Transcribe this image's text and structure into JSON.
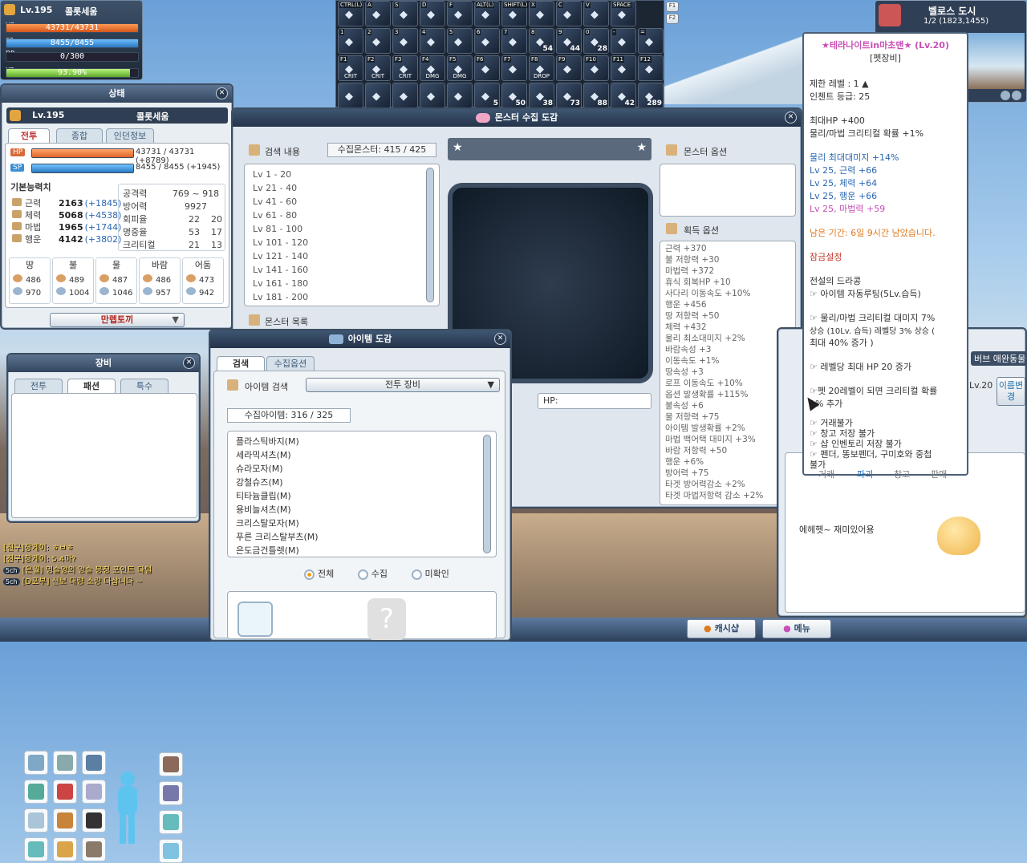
{
  "player": {
    "level": "Lv.195",
    "name": "콜롯세움",
    "hp_label": "HP",
    "mp_label": "SP",
    "dp_label": "DP",
    "xp_label": "XP",
    "hp": "43731/43731",
    "mp": "8455/8455",
    "dp": "0/300",
    "exp": "93.90%",
    "exp_fill": 0.939
  },
  "skills": {
    "row1": [
      {
        "key": "CTRL(L)"
      },
      {
        "key": "A"
      },
      {
        "key": "S"
      },
      {
        "key": "D"
      },
      {
        "key": "F"
      },
      {
        "key": "ALT(L)"
      },
      {
        "key": "SHIFT(L)"
      },
      {
        "key": "X"
      },
      {
        "key": "C"
      },
      {
        "key": "V"
      },
      {
        "key": "SPACE"
      }
    ],
    "row2": [
      {
        "key": "1"
      },
      {
        "key": "2"
      },
      {
        "key": "3"
      },
      {
        "key": "4"
      },
      {
        "key": "5"
      },
      {
        "key": "6"
      },
      {
        "key": "7"
      },
      {
        "key": "8"
      },
      {
        "key": "9"
      },
      {
        "key": "0"
      },
      {
        "key": "-"
      },
      {
        "key": "="
      }
    ],
    "row2_counts": [
      "",
      "",
      "",
      "",
      "",
      "",
      "",
      "54",
      "44",
      "28",
      "",
      ""
    ],
    "row3": [
      {
        "key": "F1",
        "label": "CRIT"
      },
      {
        "key": "F2",
        "label": "CRIT"
      },
      {
        "key": "F3",
        "label": "CRIT"
      },
      {
        "key": "F4",
        "label": "DMG"
      },
      {
        "key": "F5",
        "label": "DMG"
      },
      {
        "key": "F6",
        "label": ""
      },
      {
        "key": "F7",
        "label": ""
      },
      {
        "key": "F8",
        "label": "DROP"
      },
      {
        "key": "F9",
        "label": ""
      },
      {
        "key": "F10",
        "label": ""
      },
      {
        "key": "F11",
        "label": ""
      },
      {
        "key": "F12",
        "label": ""
      }
    ],
    "row4_counts": [
      "",
      "",
      "",
      "",
      "",
      "5",
      "50",
      "38",
      "73",
      "88",
      "42",
      "289"
    ],
    "pages": [
      "F1",
      "F2"
    ]
  },
  "minimap": {
    "title": "벨로스 도시",
    "coords": "1/2 (1823,1455)"
  },
  "status": {
    "title": "상태",
    "level": "Lv.195",
    "name": "콜롯세움",
    "tabs": [
      "전투",
      "종합",
      "인던정보"
    ],
    "hp_label": "HP",
    "hp": "43731 / 43731 (+8789)",
    "sp_label": "SP",
    "sp": "8455 / 8455 (+1945)",
    "section": "기본능력치",
    "stats": [
      {
        "name": "근력",
        "value": "2163",
        "bonus": "(+1845)"
      },
      {
        "name": "체력",
        "value": "5068",
        "bonus": "(+4538)"
      },
      {
        "name": "마법",
        "value": "1965",
        "bonus": "(+1744)"
      },
      {
        "name": "행운",
        "value": "4142",
        "bonus": "(+3802)"
      }
    ],
    "combat": [
      {
        "name": "공격력",
        "value": "769 ~ 918"
      },
      {
        "name": "방어력",
        "value": "9927"
      },
      {
        "name": "회피율",
        "v1": "22",
        "v2": "20"
      },
      {
        "name": "명중율",
        "v1": "53",
        "v2": "17"
      },
      {
        "name": "크리티컬",
        "v1": "21",
        "v2": "13"
      }
    ],
    "elements": [
      {
        "name": "땅",
        "a": "486",
        "b": "970"
      },
      {
        "name": "불",
        "a": "489",
        "b": "1004"
      },
      {
        "name": "물",
        "a": "487",
        "b": "1046"
      },
      {
        "name": "바람",
        "a": "486",
        "b": "957"
      },
      {
        "name": "어둠",
        "a": "473",
        "b": "942"
      }
    ],
    "bottom_button": "만렙토끼"
  },
  "equip": {
    "title": "장비",
    "tabs": [
      "전투",
      "패션",
      "특수"
    ]
  },
  "chat": {
    "lines": [
      "[친구]장게이: ㅎㅂㅎ",
      "[친구]장게이: 5.4마?",
      "[은월] 멍슬양의 양슬 뭉정 포인트 다털",
      "[D포부] 신보 대량 소량 다삽니다 ~"
    ],
    "channel": "5ch"
  },
  "monster_book": {
    "title": "몬스터 수집 도감",
    "search_title": "검색 내용",
    "collected": "수집몬스터: 415 / 425",
    "ranges": [
      "Lv 1 - 20",
      "Lv 21 - 40",
      "Lv 41 - 60",
      "Lv 61 - 80",
      "Lv 81 - 100",
      "Lv 101 - 120",
      "Lv 121 - 140",
      "Lv 141 - 160",
      "Lv 161 - 180",
      "Lv 181 - 200"
    ],
    "monster_list": "몬스터 목록",
    "monster_option": "몬스터 옵션",
    "gain_option": "획득 옵션",
    "gain_list": [
      "근력 +370",
      "불 저항력 +30",
      "마법력 +372",
      "휴식 회복HP +10",
      "사다리 이동속도 +10%",
      "행운 +456",
      "땅 저항력 +50",
      "체력 +432",
      "물리 최소대미지 +2%",
      "바람속성 +3",
      "이동속도 +1%",
      "땅속성 +3",
      "로프 이동속도 +10%",
      "옵션 발생확률 +115%",
      "불속성 +6",
      "물 저항력 +75",
      "아이템 발생확률 +2%",
      "마법 백어택 대미지 +3%",
      "바람 저항력 +50",
      "행운 +6%",
      "방어력 +75",
      "타겟 방어력감소 +2%",
      "타겟 마법저항력 감소 +2%"
    ],
    "hp_label": "HP:"
  },
  "item_book": {
    "title": "아이템 도감",
    "tabs": [
      "검색",
      "수집옵션"
    ],
    "search_label": "아이템 검색",
    "category": "전투 장비",
    "collected": "수집아이템: 316 / 325",
    "items": [
      "플라스틱바지(M)",
      "세라믹셔츠(M)",
      "슈라모자(M)",
      "강철슈즈(M)",
      "티타늄클립(M)",
      "용비늘셔츠(M)",
      "크리스탈모자(M)",
      "푸른 크리스탈부츠(M)",
      "은도금건틀렛(M)"
    ],
    "filters": [
      "전체",
      "수집",
      "미확인"
    ]
  },
  "tooltip": {
    "name": "★테라나이트in마초맨★ (Lv.20)",
    "type": "[펫장비]",
    "req": "제한 레벨 : 1 ▲",
    "enchant": "인첸트 등급: 25",
    "opt1": "최대HP +400",
    "opt2": "물리/마법 크리티컬 확률 +1%",
    "opt3": "물리 최대대미지 +14%",
    "lv_opts": [
      "Lv 25, 근력 +66",
      "Lv 25, 체력 +64",
      "Lv 25, 행운 +66"
    ],
    "lv_opt_pink": "Lv 25, 마법력 +59",
    "remain": "남은 기간: 6일 9시간 남았습니다.",
    "lock": "잠금설정",
    "skill_title": "전설의 드라콩",
    "s1": "☞ 아이템 자동루팅(5Lv.습득)",
    "s2a": "☞ 물리/마법 크리티컬 대미지 7%",
    "s2b": "상승 (10Lv. 습득) 레벨당 3% 상승 (",
    "s2c": "최대 40% 증가 )",
    "s3": "☞ 레벨당 최대 HP 20 증가",
    "s4a": "☞펫 20레벨이 되면 크리티컬 확률",
    "s4b": "1% 추가",
    "r1": "☞ 거래불가",
    "r2": "☞ 창고 저장 불가",
    "r3": "☞ 샵 인벤토리 저장 불가",
    "r4a": "☞ 펜더, 똥보펜더, 구미호와 중첩",
    "r4b": "불가",
    "buttons": [
      "거래",
      "파괴",
      "창고",
      "판매"
    ]
  },
  "pet": {
    "level": "Lv.20",
    "msg": "에헤헷~ 재미있어용",
    "side_label": "버브 애완동물",
    "btn": "이름변경"
  },
  "bottom": {
    "cash_shop": "캐시샵",
    "menu": "메뉴"
  },
  "colors": {
    "accent": "#c0392b",
    "pink": "#c84fb5",
    "orange": "#e07a1f",
    "hp": "#e8662d",
    "sp": "#3a8fd6"
  }
}
